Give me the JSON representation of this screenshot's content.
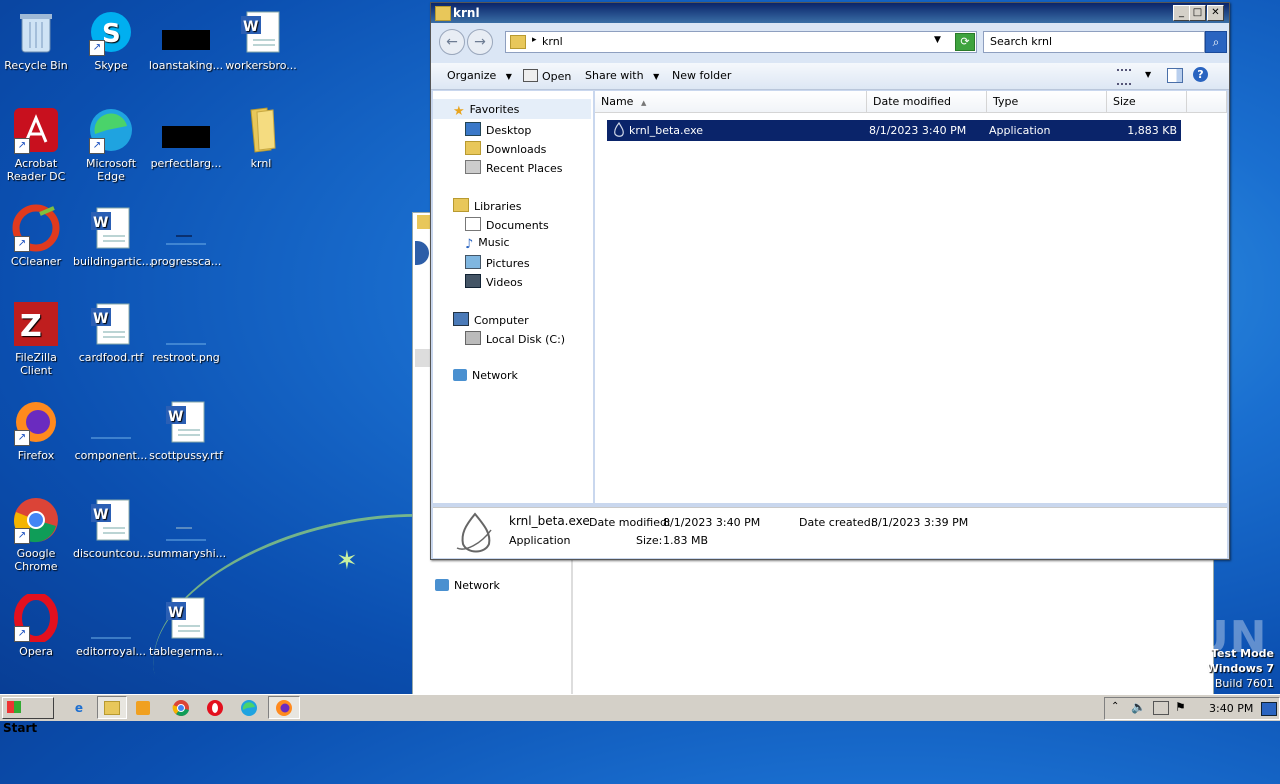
{
  "desktop": {
    "icons": [
      {
        "label": "Recycle Bin"
      },
      {
        "label": "Skype"
      },
      {
        "label": "loanstaking..."
      },
      {
        "label": "workersbro..."
      },
      {
        "label": "Acrobat Reader DC"
      },
      {
        "label": "Microsoft Edge"
      },
      {
        "label": "perfectlarg..."
      },
      {
        "label": "krnl"
      },
      {
        "label": "CCleaner"
      },
      {
        "label": "buildingartic..."
      },
      {
        "label": "progressca..."
      },
      {
        "label": "FileZilla Client"
      },
      {
        "label": "cardfood.rtf"
      },
      {
        "label": "restroot.png"
      },
      {
        "label": "Firefox"
      },
      {
        "label": "component..."
      },
      {
        "label": "scottpussy.rtf"
      },
      {
        "label": "Google Chrome"
      },
      {
        "label": "discountcou..."
      },
      {
        "label": "summaryshi..."
      },
      {
        "label": "Opera"
      },
      {
        "label": "editorroyal..."
      },
      {
        "label": "tablegerma..."
      }
    ]
  },
  "explorer": {
    "title": "krnl",
    "address": "krnl",
    "search_placeholder": "Search krnl",
    "toolbar": {
      "organize": "Organize",
      "open": "Open",
      "share_with": "Share with",
      "new_folder": "New folder"
    },
    "nav": {
      "favorites": "Favorites",
      "desktop": "Desktop",
      "downloads": "Downloads",
      "recent_places": "Recent Places",
      "libraries": "Libraries",
      "documents": "Documents",
      "music": "Music",
      "pictures": "Pictures",
      "videos": "Videos",
      "computer": "Computer",
      "local_disk": "Local Disk (C:)",
      "network": "Network"
    },
    "columns": {
      "name": "Name",
      "date_modified": "Date modified",
      "type": "Type",
      "size": "Size"
    },
    "file": {
      "name": "krnl_beta.exe",
      "date_modified": "8/1/2023 3:40 PM",
      "type": "Application",
      "size": "1,883 KB"
    },
    "details": {
      "name": "krnl_beta.exe",
      "type": "Application",
      "date_modified_label": "Date modified:",
      "date_modified": "8/1/2023 3:40 PM",
      "size_label": "Size:",
      "size": "1.83 MB",
      "date_created_label": "Date created:",
      "date_created": "8/1/2023 3:39 PM"
    }
  },
  "back_window": {
    "network": "Network"
  },
  "taskbar": {
    "start": "Start",
    "clock": "3:40 PM"
  },
  "watermark": "ANY RUN",
  "test_mode": {
    "line1": "Test Mode",
    "line2": "Windows 7",
    "line3": "Build 7601"
  },
  "colors": {
    "selection": "#0a246a",
    "desktop": "#1a6fd0"
  }
}
